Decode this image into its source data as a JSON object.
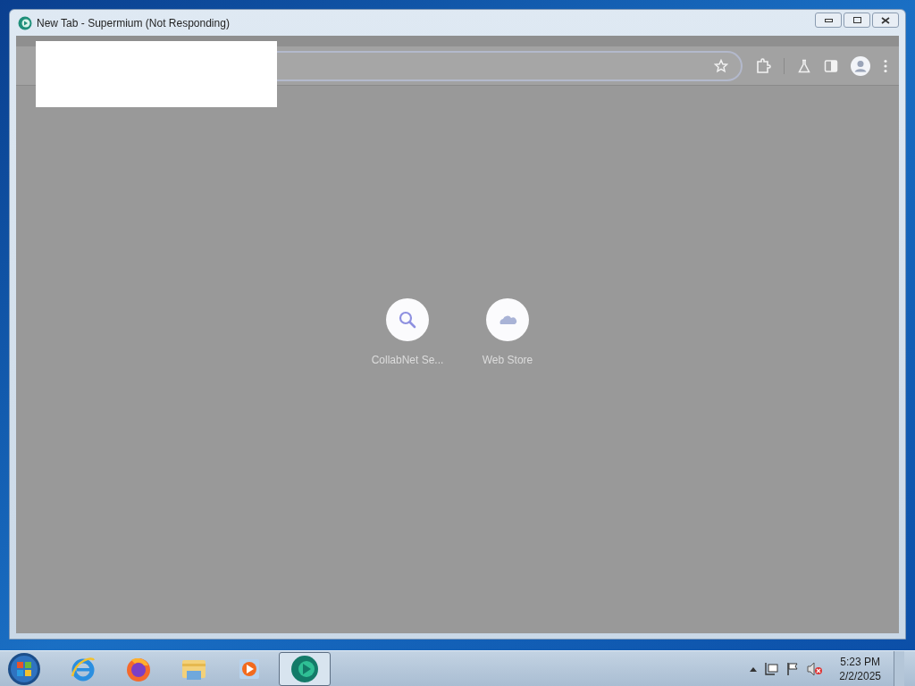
{
  "window": {
    "title": "New Tab - Supermium (Not Responding)"
  },
  "shortcuts": [
    {
      "label": "CollabNet Se...",
      "kind": "search"
    },
    {
      "label": "Web Store",
      "kind": "store"
    }
  ],
  "taskbar": {
    "apps": [
      {
        "kind": "ie",
        "selected": false
      },
      {
        "kind": "firefox",
        "selected": false
      },
      {
        "kind": "explorer",
        "selected": false
      },
      {
        "kind": "media",
        "selected": false
      },
      {
        "kind": "supermium",
        "selected": true
      }
    ],
    "time": "5:23 PM",
    "date": "2/2/2025"
  }
}
